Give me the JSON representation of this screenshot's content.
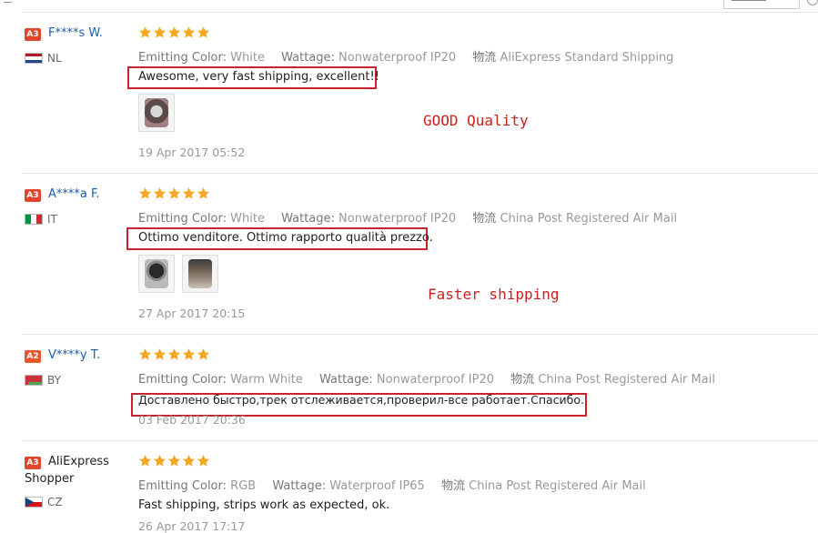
{
  "colors": {
    "accent_link": "#1a5ea8",
    "annotation_red": "#c8242e",
    "star_orange": "#f5a623",
    "level_red": "#e1452d"
  },
  "labels": {
    "emitting_color": "Emitting Color:",
    "wattage": "Wattage:",
    "logistics": "物流"
  },
  "reviews": [
    {
      "level": "A3",
      "buyer": "F****s W.",
      "buyer_line2": "",
      "country": "NL",
      "flag": "nl",
      "rating": 5,
      "emitting_color": "White",
      "wattage": "Nonwaterproof IP20",
      "shipping": "AliExpress Standard Shipping",
      "feedback": "Awesome, very fast shipping, excellent!!",
      "photos": 1,
      "annotation": "GOOD Quality",
      "date": "19 Apr 2017 05:52"
    },
    {
      "level": "A3",
      "buyer": "A****a F.",
      "buyer_line2": "",
      "country": "IT",
      "flag": "it",
      "rating": 5,
      "emitting_color": "White",
      "wattage": "Nonwaterproof IP20",
      "shipping": "China Post Registered Air Mail",
      "feedback": "Ottimo venditore. Ottimo rapporto qualità prezzo.",
      "photos": 2,
      "annotation": "Faster shipping",
      "date": "27 Apr 2017 20:15"
    },
    {
      "level": "A2",
      "buyer": "V****y T.",
      "buyer_line2": "",
      "country": "BY",
      "flag": "by",
      "rating": 5,
      "emitting_color": "Warm White",
      "wattage": "Nonwaterproof IP20",
      "shipping": "China Post Registered Air Mail",
      "feedback": "Доставлено быстро,трек отслеживается,проверил-все работает.Спасибо.",
      "photos": 0,
      "annotation": "",
      "date": "03 Feb 2017 20:36"
    },
    {
      "level": "A3",
      "buyer": "AliExpress",
      "buyer_line2": "Shopper",
      "country": "CZ",
      "flag": "cz",
      "rating": 5,
      "emitting_color": "RGB",
      "wattage": "Waterproof IP65",
      "shipping": "China Post Registered Air Mail",
      "feedback": "Fast shipping, strips work as expected, ok.",
      "photos": 0,
      "annotation": "",
      "date": "26 Apr 2017 17:17"
    }
  ]
}
